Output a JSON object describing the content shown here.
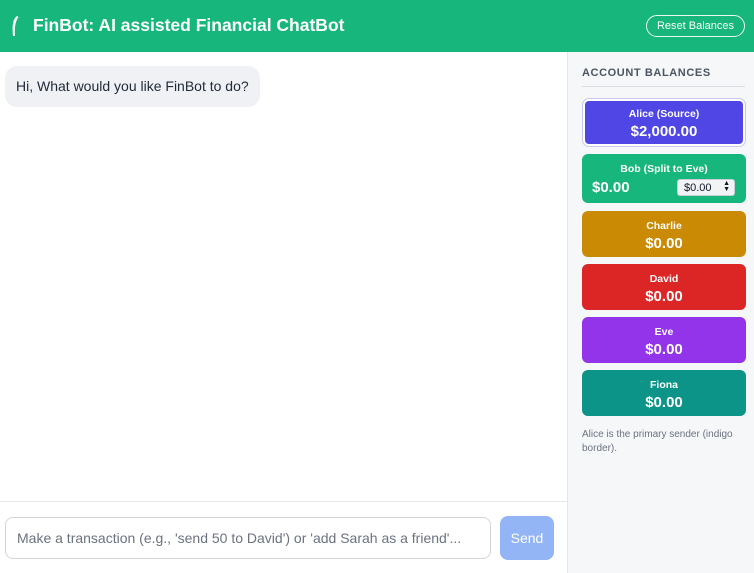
{
  "header": {
    "title": "FinBot: AI assisted Financial ChatBot",
    "reset_label": "Reset Balances",
    "brand_color": "#16b67c"
  },
  "chat": {
    "messages": [
      {
        "sender": "bot",
        "text": "Hi, What would you like FinBot to do?"
      }
    ]
  },
  "composer": {
    "placeholder": "Make a transaction (e.g., 'send 50 to David') or 'add Sarah as a friend'...",
    "value": "",
    "send_label": "Send"
  },
  "sidebar": {
    "title": "ACCOUNT BALANCES",
    "accounts": [
      {
        "name": "Alice (Source)",
        "balance": "$2,000.00",
        "color": "#4f46e5"
      },
      {
        "name": "Bob (Split to Eve)",
        "balance": "$0.00",
        "split_value": "$0.00",
        "color": "#16b67c"
      },
      {
        "name": "Charlie",
        "balance": "$0.00",
        "color": "#ca8a04"
      },
      {
        "name": "David",
        "balance": "$0.00",
        "color": "#dc2626"
      },
      {
        "name": "Eve",
        "balance": "$0.00",
        "color": "#9333ea"
      },
      {
        "name": "Fiona",
        "balance": "$0.00",
        "color": "#0d9488"
      }
    ],
    "note": "Alice is the primary sender (indigo border)."
  }
}
